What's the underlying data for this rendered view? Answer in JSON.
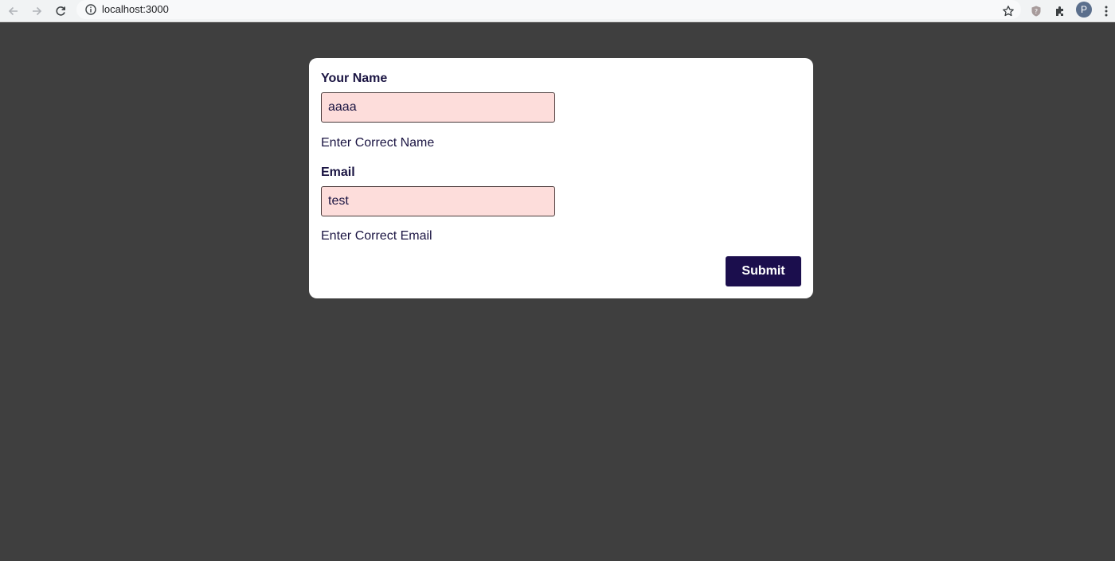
{
  "browser": {
    "url": "localhost:3000",
    "avatar_letter": "P",
    "icons": [
      "back-arrow-icon",
      "forward-arrow-icon",
      "reload-icon",
      "info-icon",
      "star-icon",
      "shield-extension-icon",
      "puzzle-extensions-icon",
      "kebab-menu-icon"
    ]
  },
  "form": {
    "name_label": "Your Name",
    "name_value": "aaaa",
    "name_error": "Enter Correct Name",
    "email_label": "Email",
    "email_value": "test",
    "email_error": "Enter Correct Email",
    "submit_label": "Submit"
  },
  "colors": {
    "page_background": "#3f3f3f",
    "card_background": "#ffffff",
    "invalid_field_background": "#fddddb",
    "submit_background": "#1b0e4d",
    "text": "#1a1442"
  }
}
